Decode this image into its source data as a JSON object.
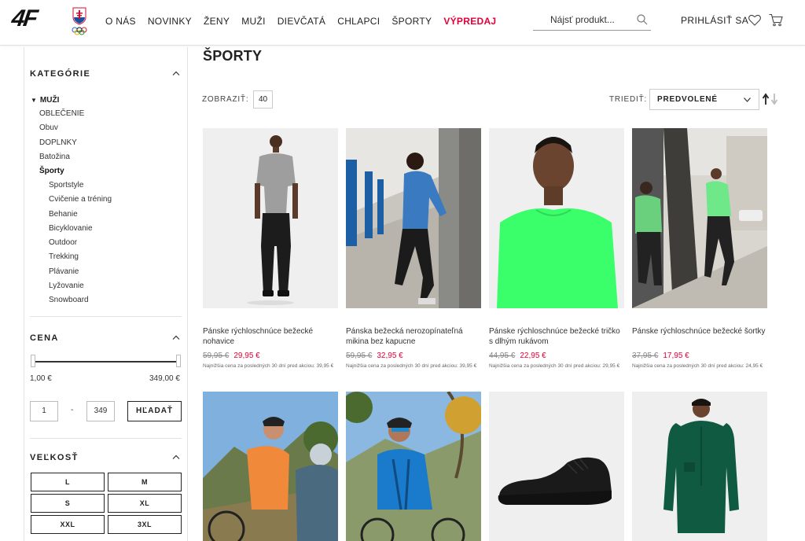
{
  "header": {
    "logo": "4F",
    "nav": [
      "O NÁS",
      "NOVINKY",
      "ŽENY",
      "MUŽI",
      "DIEVČATÁ",
      "CHLAPCI",
      "ŠPORTY",
      "VÝPREDAJ"
    ],
    "search_placeholder": "Nájsť produkt...",
    "login": "PRIHLÁSIŤ SA"
  },
  "sidebar": {
    "categories_title": "KATEGÓRIE",
    "root": "MUŽI",
    "categories": [
      "OBLEČENIE",
      "Obuv",
      "DOPLNKY",
      "Batožina",
      "Športy"
    ],
    "active_category": "Športy",
    "subcategories": [
      "Sportstyle",
      "Cvičenie a tréning",
      "Behanie",
      "Bicyklovanie",
      "Outdoor",
      "Trekking",
      "Plávanie",
      "Lyžovanie",
      "Snowboard"
    ],
    "price_title": "CENA",
    "price_min_label": "1,00 €",
    "price_max_label": "349,00 €",
    "price_min_input": "1",
    "price_max_input": "349",
    "price_separator": "-",
    "search_button": "HĽADAŤ",
    "size_title": "VEĽKOSŤ",
    "sizes": [
      "L",
      "M",
      "S",
      "XL",
      "XXL",
      "3XL"
    ]
  },
  "main": {
    "title": "ŠPORTY",
    "show_label": "ZOBRAZIŤ:",
    "show_value": "40",
    "sort_label": "TRIEDIŤ:",
    "sort_value": "PREDVOLENÉ",
    "products": [
      {
        "name": "Pánske rýchloschnúce bežecké nohavice",
        "old_price": "59,95 €",
        "price": "29,95 €",
        "note": "Najnižšia cena za posledných 30 dní pred akciou: 39,95 €"
      },
      {
        "name": "Pánska bežecká nerozopínateľná mikina bez kapucne",
        "old_price": "59,95 €",
        "price": "32,95 €",
        "note": "Najnižšia cena za posledných 30 dní pred akciou: 39,95 €"
      },
      {
        "name": "Pánske rýchloschnúce bežecké tričko s dlhým rukávom",
        "old_price": "44,95 €",
        "price": "22,95 €",
        "note": "Najnižšia cena za posledných 30 dní pred akciou: 29,95 €"
      },
      {
        "name": "Pánske rýchloschnúce bežecké šortky",
        "old_price": "37,95 €",
        "price": "17,95 €",
        "note": "Najnižšia cena za posledných 30 dní pred akciou: 24,95 €"
      }
    ]
  },
  "colors": {
    "sale": "#e4003a",
    "text": "#222222",
    "border": "#e2e2e2"
  }
}
